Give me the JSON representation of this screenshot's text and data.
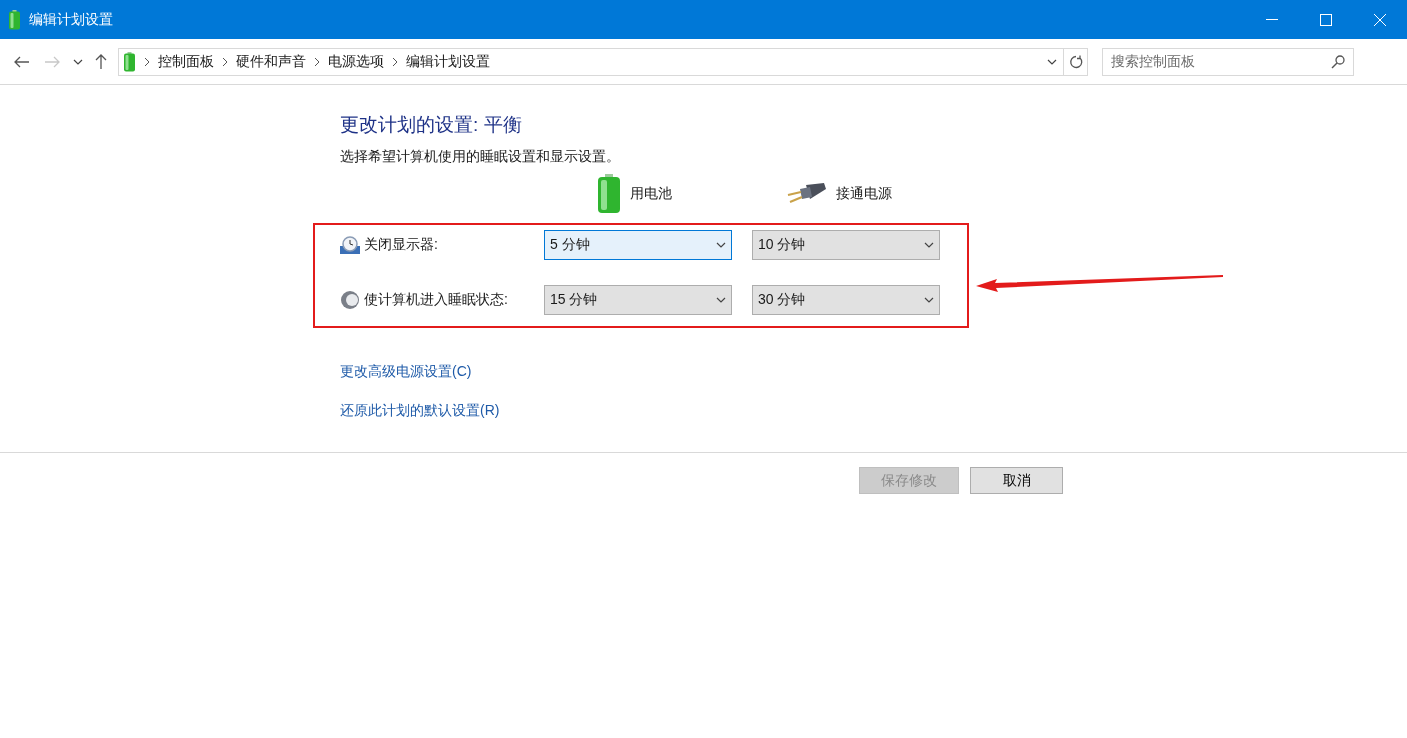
{
  "window": {
    "title": "编辑计划设置"
  },
  "breadcrumb": [
    "控制面板",
    "硬件和声音",
    "电源选项",
    "编辑计划设置"
  ],
  "search": {
    "placeholder": "搜索控制面板"
  },
  "heading": "更改计划的设置: 平衡",
  "subtitle": "选择希望计算机使用的睡眠设置和显示设置。",
  "columns": [
    {
      "kind": "battery",
      "label": "用电池"
    },
    {
      "kind": "plug",
      "label": "接通电源"
    }
  ],
  "settings": [
    {
      "kind": "display",
      "label": "关闭显示器:",
      "values": [
        {
          "value": "5 分钟",
          "focused": true
        },
        {
          "value": "10 分钟",
          "focused": false
        }
      ]
    },
    {
      "kind": "sleep",
      "label": "使计算机进入睡眠状态:",
      "values": [
        {
          "value": "15 分钟",
          "focused": false
        },
        {
          "value": "30 分钟",
          "focused": false
        }
      ]
    }
  ],
  "links": [
    "更改高级电源设置(C)",
    "还原此计划的默认设置(R)"
  ],
  "buttons": [
    {
      "label": "保存修改",
      "disabled": true
    },
    {
      "label": "取消",
      "disabled": false
    }
  ]
}
